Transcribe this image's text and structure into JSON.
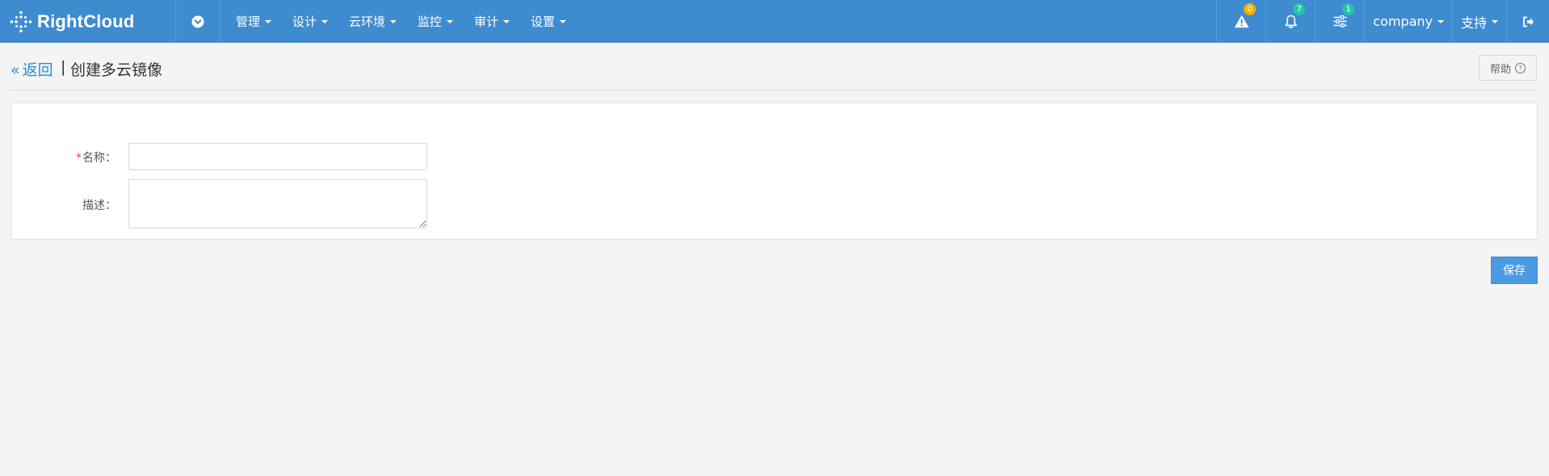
{
  "navbar": {
    "brand": "RightCloud",
    "menu": [
      {
        "label": "管理"
      },
      {
        "label": "设计"
      },
      {
        "label": "云环境"
      },
      {
        "label": "监控"
      },
      {
        "label": "审计"
      },
      {
        "label": "设置"
      }
    ],
    "alerts_badge": "0",
    "notifications_badge": "7",
    "settings_badge": "1",
    "user_label": "company",
    "support_label": "支持",
    "colors": {
      "bar": "#3f8bd0",
      "alert_badge": "#f0b400",
      "notify_badge": "#1fc8a8"
    }
  },
  "page": {
    "back_label": "返回",
    "separator": "|",
    "title": "创建多云镜像",
    "help_label": "帮助"
  },
  "form": {
    "required_mark": "*",
    "name_label": "名称：",
    "name_value": "",
    "desc_label": "描述：",
    "desc_value": ""
  },
  "actions": {
    "save_label": "保存"
  }
}
